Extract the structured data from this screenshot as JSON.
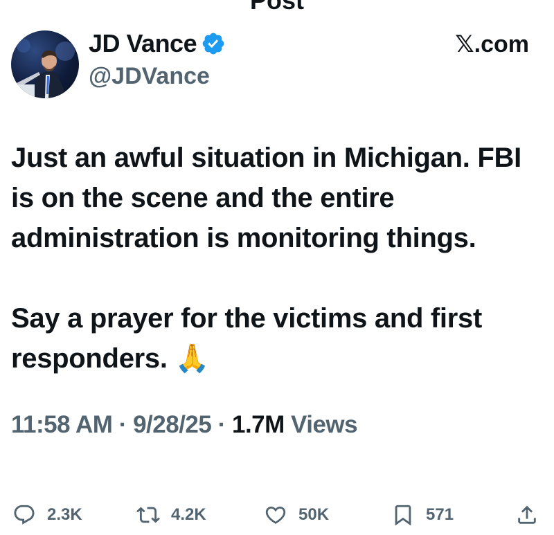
{
  "header": {
    "title": "Post"
  },
  "author": {
    "name": "JD Vance",
    "handle": "@JDVance",
    "verified": true,
    "verified_color": "#1d9bf0"
  },
  "source": "𝕏.com",
  "tweet": {
    "paragraph1": "Just an awful situation in Michigan. FBI is on the scene and the entire administration is monitoring things.",
    "paragraph2": "Say a prayer for the victims and first responders. 🙏"
  },
  "meta": {
    "time": "11:58 AM",
    "date": "9/28/25",
    "views_count": "1.7M",
    "views_label": "Views",
    "separator": "·"
  },
  "actions": {
    "replies": "2.3K",
    "reposts": "4.2K",
    "likes": "50K",
    "bookmarks": "571"
  },
  "colors": {
    "text": "#0f1419",
    "secondary": "#536471"
  }
}
